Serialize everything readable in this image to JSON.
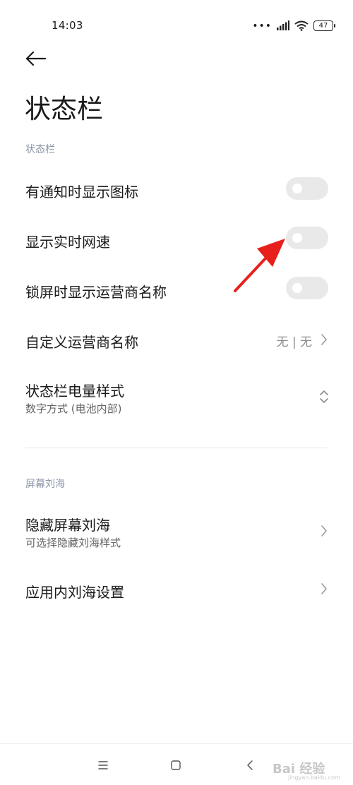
{
  "status_bar": {
    "time": "14:03",
    "battery": "47",
    "signal_dots": "•••"
  },
  "header": {
    "title": "状态栏"
  },
  "sections": {
    "status_bar": {
      "label": "状态栏"
    },
    "notch": {
      "label": "屏幕刘海"
    }
  },
  "rows": {
    "notify_icons": {
      "title": "有通知时显示图标",
      "toggle_on": false
    },
    "network_speed": {
      "title": "显示实时网速",
      "toggle_on": false
    },
    "lock_carrier": {
      "title": "锁屏时显示运营商名称",
      "toggle_on": false
    },
    "custom_carrier": {
      "title": "自定义运营商名称",
      "value": "无 | 无"
    },
    "battery_style": {
      "title": "状态栏电量样式",
      "subtitle": "数字方式 (电池内部)"
    },
    "hide_notch": {
      "title": "隐藏屏幕刘海",
      "subtitle": "可选择隐藏刘海样式"
    },
    "app_notch": {
      "title": "应用内刘海设置"
    }
  },
  "watermark": {
    "text": "Bai 经验",
    "sub": "jingyan.baidu.com"
  },
  "colors": {
    "toggle_off": "#e9e9e9",
    "section_label": "#8a93a8",
    "annotation_arrow": "#e8201c"
  },
  "icons": [
    "back-arrow-icon",
    "signal-icon",
    "wifi-icon",
    "battery-icon",
    "chevron-right-icon",
    "chevron-up-down-icon",
    "menu-icon",
    "home-icon",
    "back-icon"
  ]
}
